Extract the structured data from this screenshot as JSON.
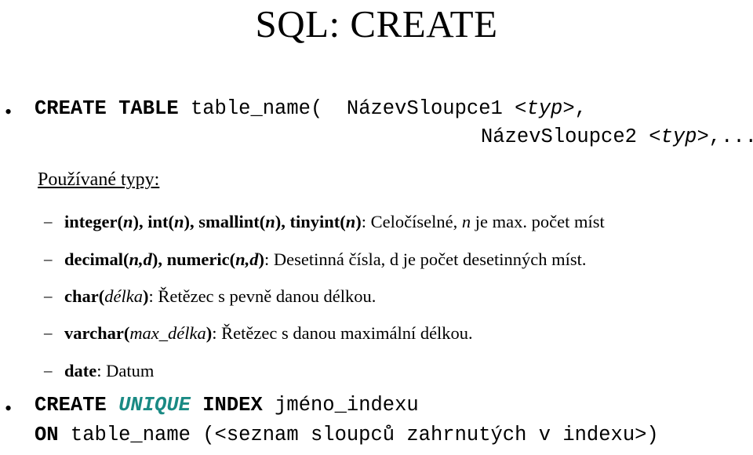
{
  "slide": {
    "title": "SQL: CREATE",
    "background_color": "#ffffff",
    "text_color": "#000000",
    "accent_color": "#1a8a84",
    "bullet_glyph": "•",
    "dash_glyph": "–"
  },
  "content": {
    "create_table": {
      "line1": {
        "keyword": "CREATE TABLE",
        "table_name": " table_name(  ",
        "column1": "NázevSloupce1 <",
        "type1_italic": "typ",
        "after_type1": ">,"
      },
      "line2": {
        "column2": "NázevSloupce2 <",
        "type2_italic": "typ",
        "after_type2": ">,...)"
      }
    },
    "types_heading": "Používané typy:",
    "types": [
      {
        "name": "integer(",
        "arg_italic": "n",
        "name_cont": "), int(",
        "arg_italic2": "n",
        "name_cont2": "), smallint(",
        "arg_italic3": "n",
        "name_cont3": "), tinyint(",
        "arg_italic4": "n",
        "name_end": ")",
        "desc_before": ": Celočíselné, ",
        "desc_italic": "n",
        "desc_after": " je max. počet míst"
      },
      {
        "name": "decimal(",
        "arg_italic": "n,d",
        "name_cont": "), numeric(",
        "arg_italic2": "n,d",
        "name_end": ")",
        "desc_before": ": Desetinná čísla, d je počet desetinných míst."
      },
      {
        "name": "char(",
        "arg_italic": "délka",
        "name_end": ")",
        "desc_before": ": Řetězec s pevně danou délkou."
      },
      {
        "name": "varchar(",
        "arg_italic": "max_délka",
        "name_end": ")",
        "desc_before": ": Řetězec s danou maximální délkou."
      },
      {
        "name": "date",
        "desc_before": ": Datum"
      }
    ],
    "create_index": {
      "line1": {
        "keyword1": "CREATE ",
        "unique": "UNIQUE",
        "keyword2": " INDEX",
        "index_name": " jméno_indexu"
      },
      "line2": {
        "keyword": "ON",
        "rest": " table_name (<seznam sloupců zahrnutých v indexu>)"
      }
    }
  }
}
